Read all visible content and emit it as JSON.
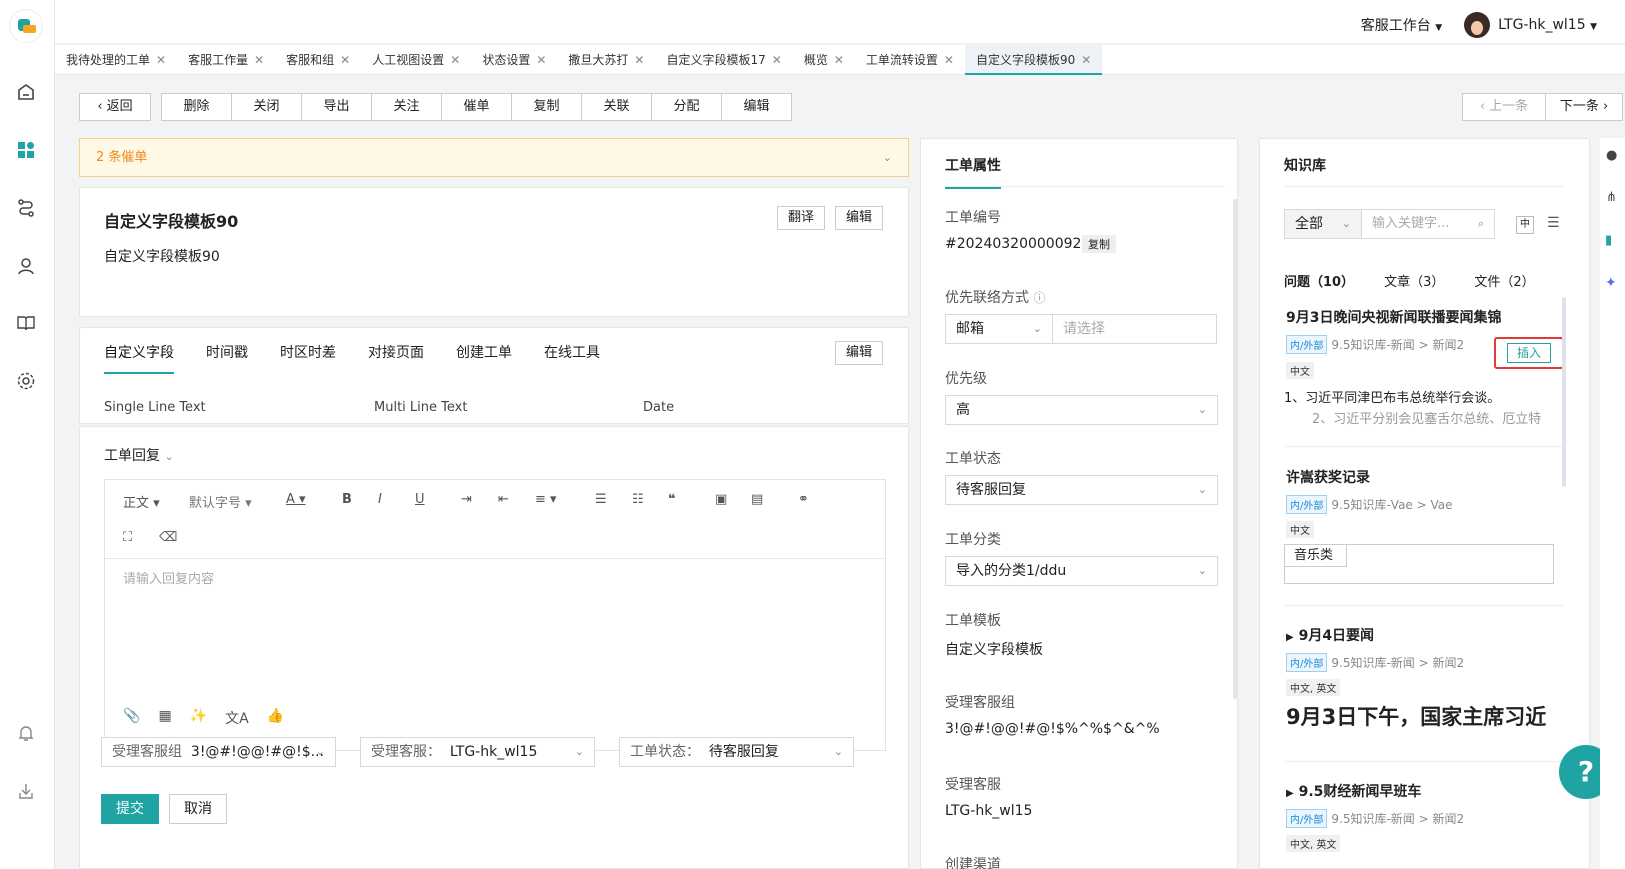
{
  "topbar": {
    "workspace": "客服工作台",
    "user": "LTG-hk_wl15"
  },
  "tabs": [
    "我待处理的工单",
    "客服工作量",
    "客服和组",
    "人工视图设置",
    "状态设置",
    "撒旦大苏打",
    "自定义字段模板17",
    "概览",
    "工单流转设置",
    "自定义字段模板90"
  ],
  "toolbar": {
    "back": "返回",
    "actions": [
      "删除",
      "关闭",
      "导出",
      "关注",
      "催单",
      "复制",
      "关联",
      "分配",
      "编辑"
    ],
    "prev": "上一条",
    "next": "下一条"
  },
  "alert": "2 条催单",
  "ticket": {
    "title": "自定义字段模板90",
    "body": "自定义字段模板90",
    "translate": "翻译",
    "edit": "编辑"
  },
  "fields_tabs": {
    "items": [
      "自定义字段",
      "时间戳",
      "时区时差",
      "对接页面",
      "创建工单",
      "在线工具"
    ],
    "edit": "编辑"
  },
  "field_cols": [
    "Single Line Text",
    "Multi Line Text",
    "Date"
  ],
  "reply": {
    "title": "工单回复",
    "toolbar_text": "正文",
    "font_size": "默认字号",
    "placeholder": "请输入回复内容",
    "group_label": "受理客服组",
    "group_value": "3!@#!@@!#@!$...",
    "agent_label": "受理客服：",
    "agent_value": "LTG-hk_wl15",
    "status_label": "工单状态：",
    "status_value": "待客服回复",
    "submit": "提交",
    "cancel": "取消"
  },
  "props": {
    "title": "工单属性",
    "id_label": "工单编号",
    "id_value": "#20240320000092",
    "copy": "复制",
    "contact_label": "优先联络方式",
    "contact_value": "邮箱",
    "contact_placeholder": "请选择",
    "priority_label": "优先级",
    "priority_value": "高",
    "status_label": "工单状态",
    "status_value": "待客服回复",
    "category_label": "工单分类",
    "category_value": "导入的分类1/ddu",
    "template_label": "工单模板",
    "template_value": "自定义字段模板",
    "group_label": "受理客服组",
    "group_value": "3!@#!@@!#@!$%^%$^&^%",
    "agent_label": "受理客服",
    "agent_value": "LTG-hk_wl15",
    "channel_label": "创建渠道"
  },
  "kb": {
    "title": "知识库",
    "filter": "全部",
    "search_placeholder": "输入关键字...",
    "lang_btn": "中",
    "tabs": [
      "问题（10）",
      "文章（3）",
      "文件（2）"
    ],
    "items": [
      {
        "title": "9月3日晚间央视新闻联播要闻集锦",
        "tag": "内/外部",
        "crumb": "9.5知识库-新闻 > 新闻2",
        "lang": "中文",
        "line1": "1、习近平同津巴布韦总统举行会谈。",
        "line2": "2、习近平分别会见塞舌尔总统、厄立特",
        "insert": "插入"
      },
      {
        "title": "许嵩获奖记录",
        "tag": "内/外部",
        "crumb": "9.5知识库-Vae > Vae",
        "lang": "中文",
        "cell": "音乐类"
      },
      {
        "title": "9月4日要闻",
        "tag": "内/外部",
        "crumb": "9.5知识库-新闻 > 新闻2",
        "lang": "中文, 英文",
        "big": "9月3日下午，国家主席习近"
      },
      {
        "title": "9.5财经新闻早班车",
        "tag": "内/外部",
        "crumb": "9.5知识库-新闻 > 新闻2",
        "lang": "中文, 英文"
      }
    ]
  },
  "colors": {
    "accent": "#1fa3a3",
    "alert_text": "#f08a1d",
    "highlight": "#e53935"
  }
}
